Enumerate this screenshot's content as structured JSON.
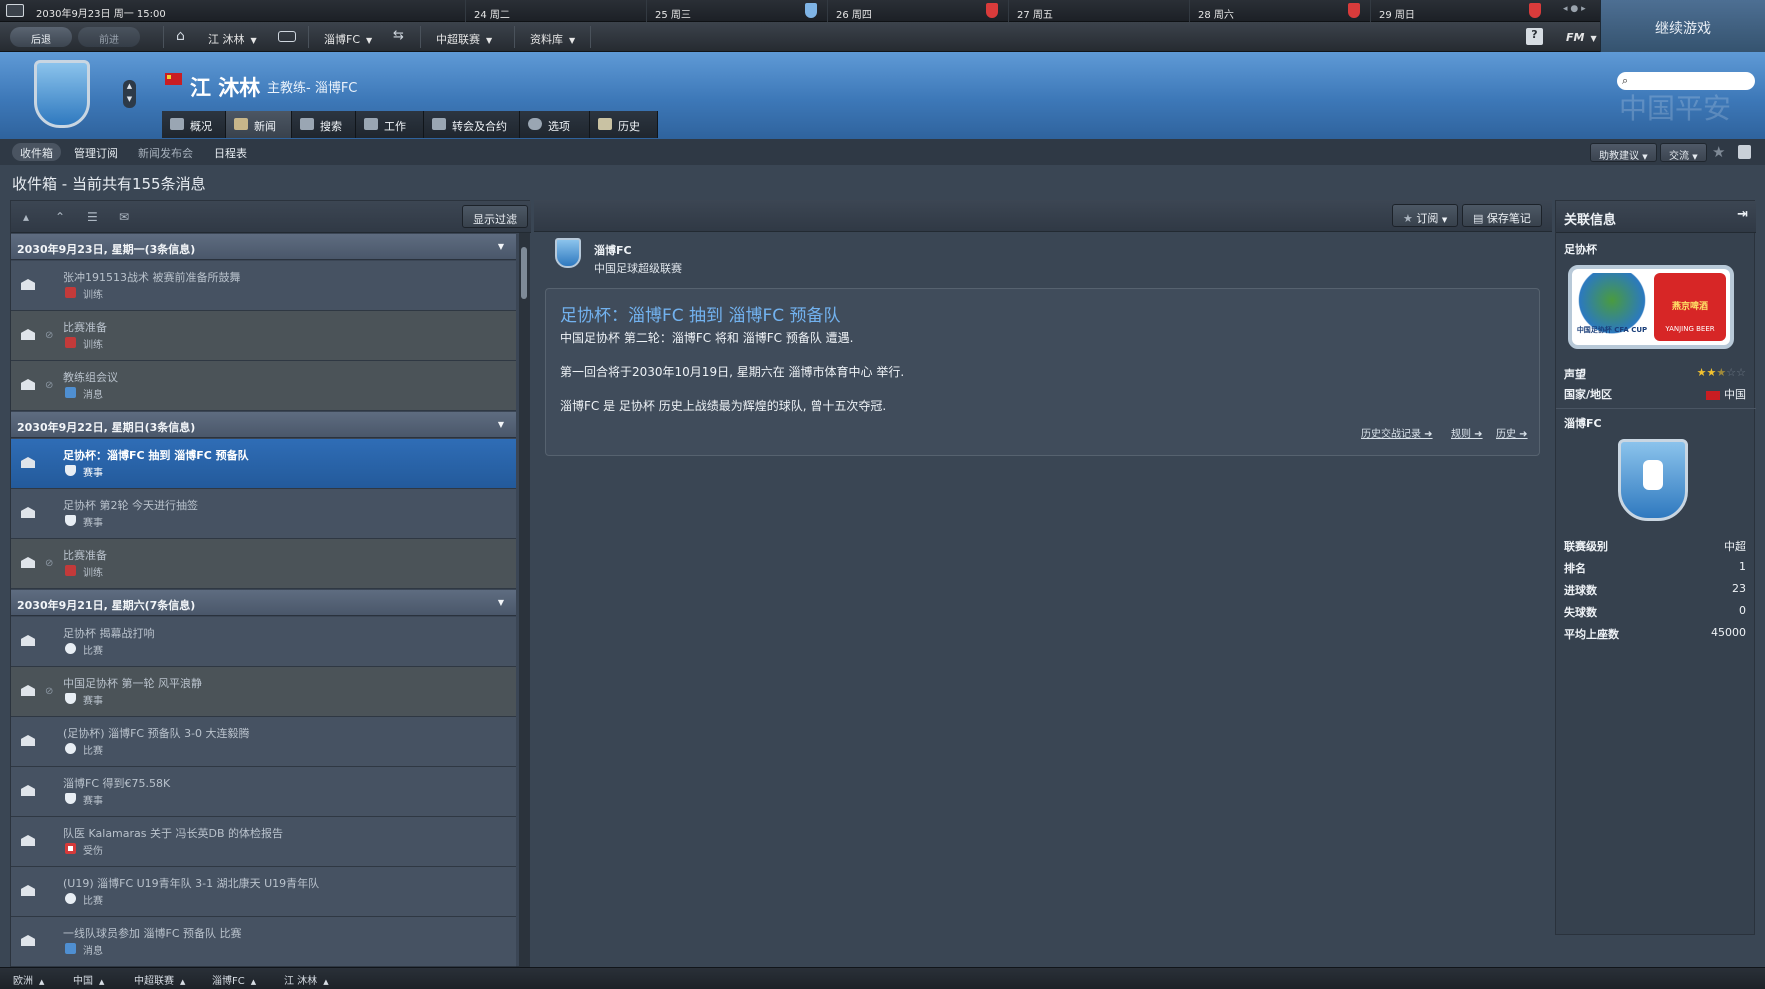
{
  "topbar": {
    "date": "2030年9月23日 周一 15:00",
    "days": [
      {
        "label": "24 周二",
        "crest_color": ""
      },
      {
        "label": "25 周三",
        "crest_color": "#7fb4e6"
      },
      {
        "label": "26 周四",
        "crest_color": "#d93b3b"
      },
      {
        "label": "27 周五",
        "crest_color": ""
      },
      {
        "label": "28 周六",
        "crest_color": ""
      },
      {
        "label": "29 周日",
        "crest_color": "#d93b3b"
      }
    ],
    "continue_label": "继续游戏"
  },
  "nav": {
    "back": "后退",
    "forward": "前进",
    "manager": "江 沐林",
    "club": "淄博FC",
    "league": "中超联赛",
    "database": "资料库",
    "help": "?",
    "fm": "FM"
  },
  "header": {
    "name": "江 沐林",
    "role": "主教练- 淄博FC",
    "tabs": [
      {
        "label": "概况",
        "icon": "overview-icon",
        "color": "#9aa6b3"
      },
      {
        "label": "新闻",
        "icon": "news-icon",
        "color": "#c7b68a"
      },
      {
        "label": "搜索",
        "icon": "search-icon",
        "color": "#9aa6b3"
      },
      {
        "label": "工作",
        "icon": "briefcase-icon",
        "color": "#9aa6b3"
      },
      {
        "label": "转会及合约",
        "icon": "contract-icon",
        "color": "#9aa6b3"
      },
      {
        "label": "选项",
        "icon": "gear-icon",
        "color": "#9aa6b3"
      },
      {
        "label": "历史",
        "icon": "history-icon",
        "color": "#c9c2a3"
      }
    ],
    "watermark": "中国平安"
  },
  "subnav": {
    "tabs": [
      "收件箱",
      "管理订阅",
      "新闻发布会",
      "日程表"
    ],
    "assistant": "助教建议",
    "interact": "交流"
  },
  "inbox": {
    "title": "收件箱 - 当前共有155条消息",
    "filter": "显示过滤",
    "groups": [
      {
        "header": "2030年9月23日, 星期一(3条信息)",
        "messages": [
          {
            "subject": "张冲191513战术 被赛前准备所鼓舞",
            "category": "训练",
            "cat_color": "#c33a3a",
            "style": "",
            "clip": false
          },
          {
            "subject": "比赛准备",
            "category": "训练",
            "cat_color": "#c33a3a",
            "style": "alt",
            "clip": true
          },
          {
            "subject": "教练组会议",
            "category": "消息",
            "cat_color": "#4f8fd1",
            "style": "alt",
            "clip": true
          }
        ]
      },
      {
        "header": "2030年9月22日, 星期日(3条信息)",
        "messages": [
          {
            "subject": "足协杯：淄博FC 抽到 淄博FC 预备队",
            "category": "赛事",
            "cat_color": "#e8eef4",
            "style": "sel",
            "clip": false
          },
          {
            "subject": "足协杯 第2轮 今天进行抽签",
            "category": "赛事",
            "cat_color": "#e8eef4",
            "style": "",
            "clip": false
          },
          {
            "subject": "比赛准备",
            "category": "训练",
            "cat_color": "#c33a3a",
            "style": "alt",
            "clip": true
          }
        ]
      },
      {
        "header": "2030年9月21日, 星期六(7条信息)",
        "messages": [
          {
            "subject": "足协杯 揭幕战打响",
            "category": "比赛",
            "cat_color": "#e8eef4",
            "style": "",
            "clip": false
          },
          {
            "subject": "中国足协杯 第一轮 风平浪静",
            "category": "赛事",
            "cat_color": "#e8eef4",
            "style": "alt",
            "clip": true
          },
          {
            "subject": "(足协杯) 淄博FC 预备队 3-0 大连毅腾",
            "category": "比赛",
            "cat_color": "#e8eef4",
            "style": "",
            "clip": false
          },
          {
            "subject": "淄博FC 得到€75.58K",
            "category": "赛事",
            "cat_color": "#e8eef4",
            "style": "",
            "clip": false
          },
          {
            "subject": "队医 Kalamaras 关于 冯长英DB 的体检报告",
            "category": "受伤",
            "cat_color": "#d63a3a",
            "style": "",
            "clip": false
          },
          {
            "subject": "(U19) 淄博FC U19青年队 3-1 湖北康天 U19青年队",
            "category": "比赛",
            "cat_color": "#e8eef4",
            "style": "",
            "clip": false
          },
          {
            "subject": "一线队球员参加 淄博FC 预备队 比赛",
            "category": "消息",
            "cat_color": "#4f8fd1",
            "style": "",
            "clip": false
          }
        ]
      }
    ]
  },
  "article": {
    "subscribe": "订阅",
    "save_note": "保存笔记",
    "sender": "淄博FC",
    "sender_league": "中国足球超级联赛",
    "title": "足协杯：淄博FC 抽到 淄博FC 预备队",
    "lines": [
      "中国足协杯 第二轮：淄博FC 将和 淄博FC 预备队 遭遇.",
      "第一回合将于2030年10月19日, 星期六在 淄博市体育中心 举行.",
      "淄博FC 是 足协杯 历史上战绩最为辉煌的球队, 曾十五次夺冠."
    ],
    "links": [
      "历史交战记录",
      "规则",
      "历史"
    ]
  },
  "related": {
    "title": "关联信息",
    "competition": "足协杯",
    "cup_logo_left": "中国足协杯 CFA CUP",
    "cup_logo_right": "燕京啤酒",
    "cup_logo_right_sub": "YANJING BEER",
    "reputation_label": "声望",
    "reputation_stars": 2.5,
    "country_label": "国家/地区",
    "country": "中国",
    "club": "淄博FC",
    "stats": [
      {
        "k": "联赛级别",
        "v": "中超"
      },
      {
        "k": "排名",
        "v": "1"
      },
      {
        "k": "进球数",
        "v": "23"
      },
      {
        "k": "失球数",
        "v": "0"
      },
      {
        "k": "平均上座数",
        "v": "45000"
      }
    ]
  },
  "breadcrumbs": [
    "欧洲",
    "中国",
    "中超联赛",
    "淄博FC",
    "江 沐林"
  ]
}
